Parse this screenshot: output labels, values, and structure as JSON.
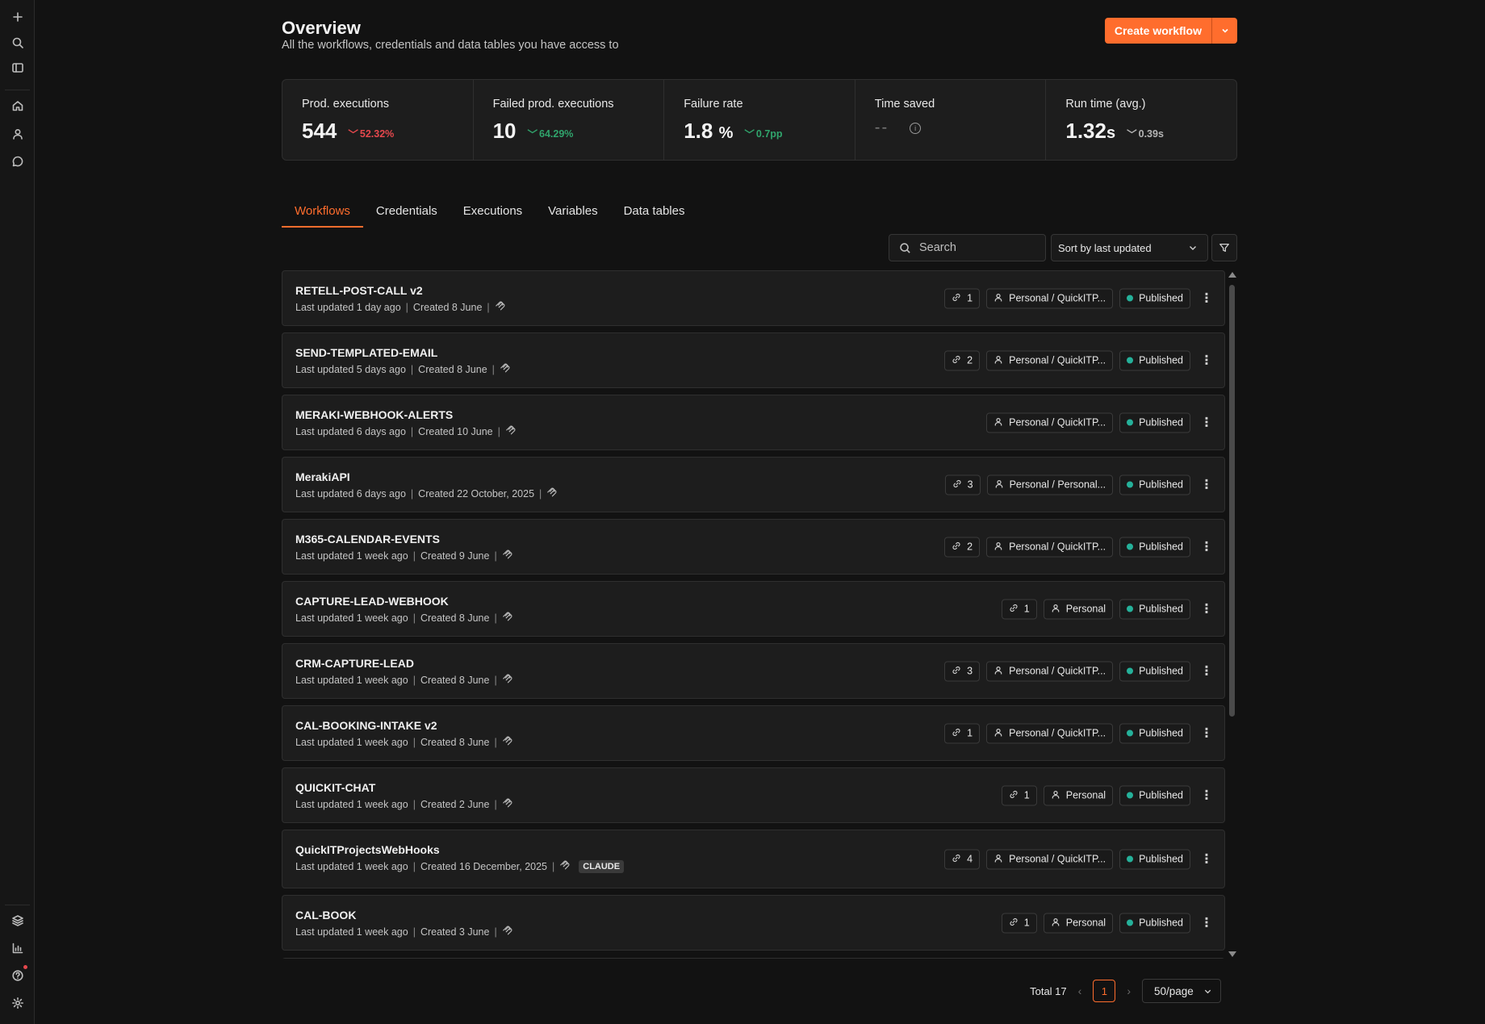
{
  "header": {
    "title": "Overview",
    "subtitle": "All the workflows, credentials and data tables you have access to",
    "create_label": "Create workflow"
  },
  "stats": [
    {
      "label": "Prod. executions",
      "value": "544",
      "unit": "",
      "delta": "52.32%",
      "trend": "down-bad"
    },
    {
      "label": "Failed prod. executions",
      "value": "10",
      "unit": "",
      "delta": "64.29%",
      "trend": "down-good"
    },
    {
      "label": "Failure rate",
      "value": "1.8",
      "unit": "%",
      "delta": "0.7pp",
      "trend": "down-good"
    },
    {
      "label": "Time saved",
      "value": "--",
      "unit": "",
      "delta": "",
      "trend": "none"
    },
    {
      "label": "Run time (avg.)",
      "value": "1.32",
      "unit": "s",
      "delta": "0.39s",
      "trend": "down-neutral"
    }
  ],
  "tabs": [
    "Workflows",
    "Credentials",
    "Executions",
    "Variables",
    "Data tables"
  ],
  "search": {
    "placeholder": "Search"
  },
  "sort": {
    "value": "Sort by last updated"
  },
  "workflows": [
    {
      "name": "RETELL-POST-CALL v2",
      "updated": "Last updated 1 day ago",
      "created": "Created 8 June",
      "links": "1",
      "owner": "Personal / QuickITP...",
      "status": "Published",
      "tag": ""
    },
    {
      "name": "SEND-TEMPLATED-EMAIL",
      "updated": "Last updated 5 days ago",
      "created": "Created 8 June",
      "links": "2",
      "owner": "Personal / QuickITP...",
      "status": "Published",
      "tag": ""
    },
    {
      "name": "MERAKI-WEBHOOK-ALERTS",
      "updated": "Last updated 6 days ago",
      "created": "Created 10 June",
      "links": "",
      "owner": "Personal / QuickITP...",
      "status": "Published",
      "tag": ""
    },
    {
      "name": "MerakiAPI",
      "updated": "Last updated 6 days ago",
      "created": "Created 22 October, 2025",
      "links": "3",
      "owner": "Personal / Personal...",
      "status": "Published",
      "tag": ""
    },
    {
      "name": "M365-CALENDAR-EVENTS",
      "updated": "Last updated 1 week ago",
      "created": "Created 9 June",
      "links": "2",
      "owner": "Personal / QuickITP...",
      "status": "Published",
      "tag": ""
    },
    {
      "name": "CAPTURE-LEAD-WEBHOOK",
      "updated": "Last updated 1 week ago",
      "created": "Created 8 June",
      "links": "1",
      "owner": "Personal",
      "status": "Published",
      "tag": ""
    },
    {
      "name": "CRM-CAPTURE-LEAD",
      "updated": "Last updated 1 week ago",
      "created": "Created 8 June",
      "links": "3",
      "owner": "Personal / QuickITP...",
      "status": "Published",
      "tag": ""
    },
    {
      "name": "CAL-BOOKING-INTAKE v2",
      "updated": "Last updated 1 week ago",
      "created": "Created 8 June",
      "links": "1",
      "owner": "Personal / QuickITP...",
      "status": "Published",
      "tag": ""
    },
    {
      "name": "QUICKIT-CHAT",
      "updated": "Last updated 1 week ago",
      "created": "Created 2 June",
      "links": "1",
      "owner": "Personal",
      "status": "Published",
      "tag": ""
    },
    {
      "name": "QuickITProjectsWebHooks",
      "updated": "Last updated 1 week ago",
      "created": "Created 16 December, 2025",
      "links": "4",
      "owner": "Personal / QuickITP...",
      "status": "Published",
      "tag": "CLAUDE"
    },
    {
      "name": "CAL-BOOK",
      "updated": "Last updated 1 week ago",
      "created": "Created 3 June",
      "links": "1",
      "owner": "Personal",
      "status": "Published",
      "tag": ""
    }
  ],
  "pagination": {
    "total": "Total 17",
    "page": "1",
    "page_size": "50/page"
  },
  "colors": {
    "accent": "#ff6d2d",
    "published": "#25b19a",
    "bad": "#e5484d",
    "good": "#30a46c"
  },
  "sidebar_icons": [
    "plus-icon",
    "search-icon",
    "panel-icon",
    "home-icon",
    "user-icon",
    "chat-icon",
    "templates-icon",
    "insights-icon",
    "help-icon",
    "settings-icon"
  ]
}
